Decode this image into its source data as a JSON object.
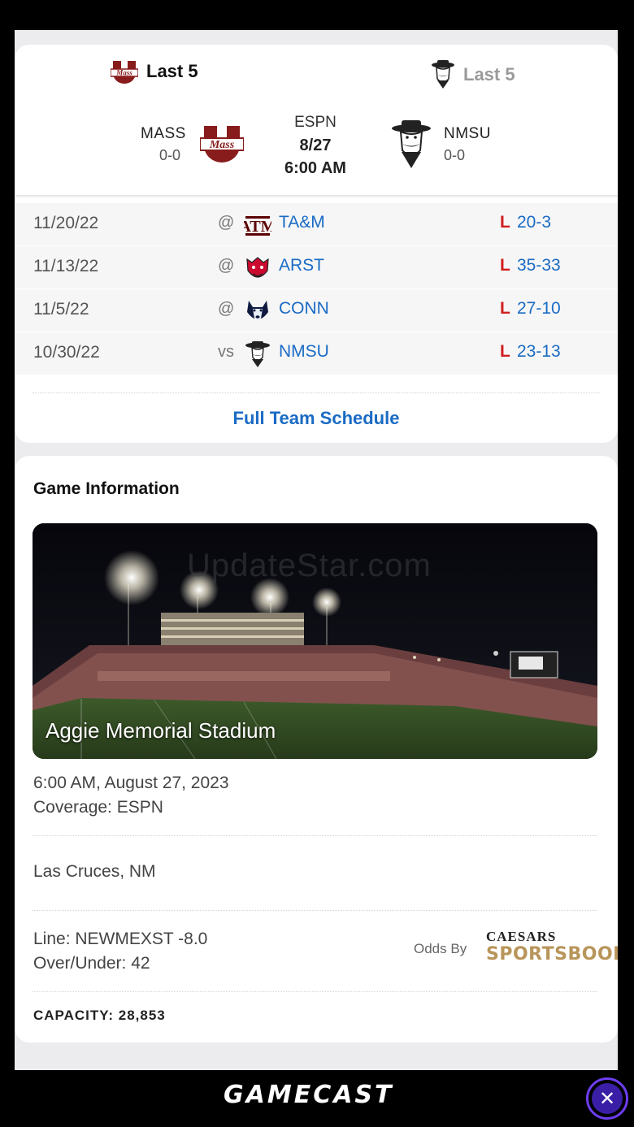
{
  "matchup": {
    "left_tab": "Last 5",
    "right_tab": "Last 5",
    "away": {
      "abbr": "MASS",
      "record": "0-0",
      "logo": "umass-logo"
    },
    "home": {
      "abbr": "NMSU",
      "record": "0-0",
      "logo": "nmsu-pistol-pete-logo"
    },
    "network": "ESPN",
    "date": "8/27",
    "time": "6:00 AM"
  },
  "last5": {
    "rows": [
      {
        "date": "11/20/22",
        "at": "@",
        "opponent": "TA&M",
        "result": "L",
        "score": "20-3",
        "logo": "texas-am-logo"
      },
      {
        "date": "11/13/22",
        "at": "@",
        "opponent": "ARST",
        "result": "L",
        "score": "35-33",
        "logo": "arkansas-state-logo"
      },
      {
        "date": "11/5/22",
        "at": "@",
        "opponent": "CONN",
        "result": "L",
        "score": "27-10",
        "logo": "uconn-husky-logo"
      },
      {
        "date": "10/30/22",
        "at": "vs",
        "opponent": "NMSU",
        "result": "L",
        "score": "23-13",
        "logo": "nmsu-pistol-pete-logo"
      }
    ],
    "full_schedule": "Full Team Schedule"
  },
  "game_info": {
    "title": "Game Information",
    "stadium": "Aggie Memorial Stadium",
    "watermark": "UpdateStar.com",
    "datetime": "6:00 AM, August 27, 2023",
    "coverage": "Coverage: ESPN",
    "location": "Las Cruces, NM",
    "line": "Line: NEWMEXST -8.0",
    "over_under": "Over/Under: 42",
    "odds_by": "Odds By",
    "sportsbook_top": "CAESARS",
    "sportsbook_bottom": "SPORTSBOOK",
    "capacity": "CAPACITY: 28,853"
  },
  "banner": {
    "title": "GAMECAST",
    "close_icon": "close-icon"
  },
  "colors": {
    "link": "#1a6bc4",
    "loss": "#d11f1f",
    "umass": "#881c1c",
    "caesars_gold": "#b8955a"
  }
}
